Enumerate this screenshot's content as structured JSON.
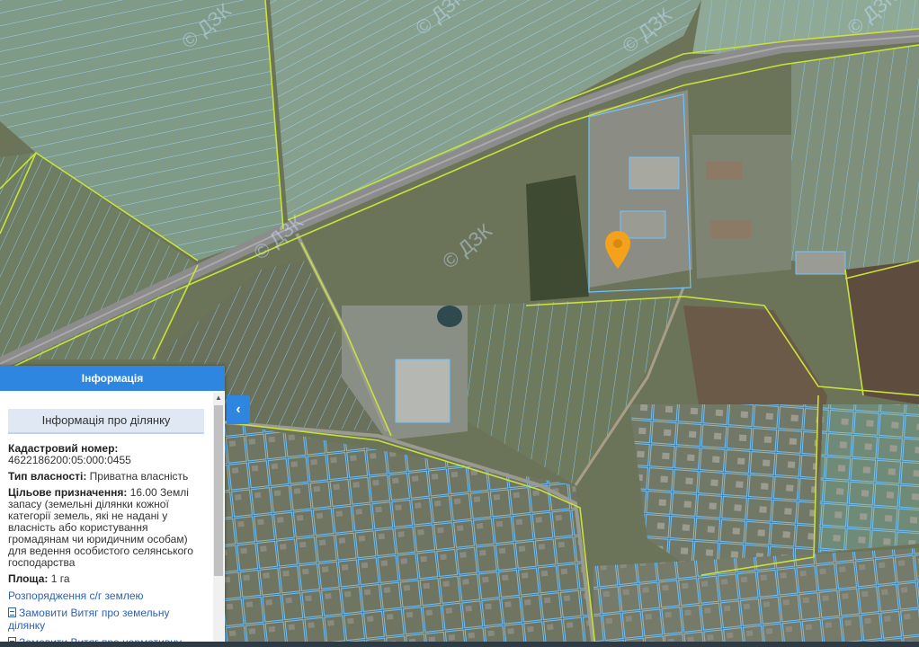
{
  "map": {
    "colors": {
      "field": "#7f9a86",
      "field_light": "#8fa996",
      "soil": "#6b5a48",
      "village": "#6f7560",
      "road": "#8c8c8c",
      "parcel_line": "#6fc3ff",
      "boundary_line": "#c8e23a",
      "marker": "#f4a11c"
    },
    "watermark": "© ДЗК",
    "marker_icon": "map-pin-icon"
  },
  "panel": {
    "header": "Інформація",
    "section_title": "Інформація про ділянку",
    "cadastral_label": "Кадастровий номер:",
    "cadastral_value": "4622186200:05:000:0455",
    "ownership_label": "Тип власності:",
    "ownership_value": "Приватна власність",
    "purpose_label": "Цільове призначення:",
    "purpose_value": "16.00 Землі запасу (земельні ділянки кожної категорії земель, які не надані у власність або користування громадянам чи юридичним особам) для ведення особистого селянського господарства",
    "area_label": "Площа:",
    "area_value": "1 га",
    "link_orders": "Розпорядження с/г землею",
    "link_extract": "Замовити Витяг про земельну ділянку",
    "link_normative": "Замовити Витяг про нормативну",
    "collapse_icon": "chevron-left-icon"
  }
}
